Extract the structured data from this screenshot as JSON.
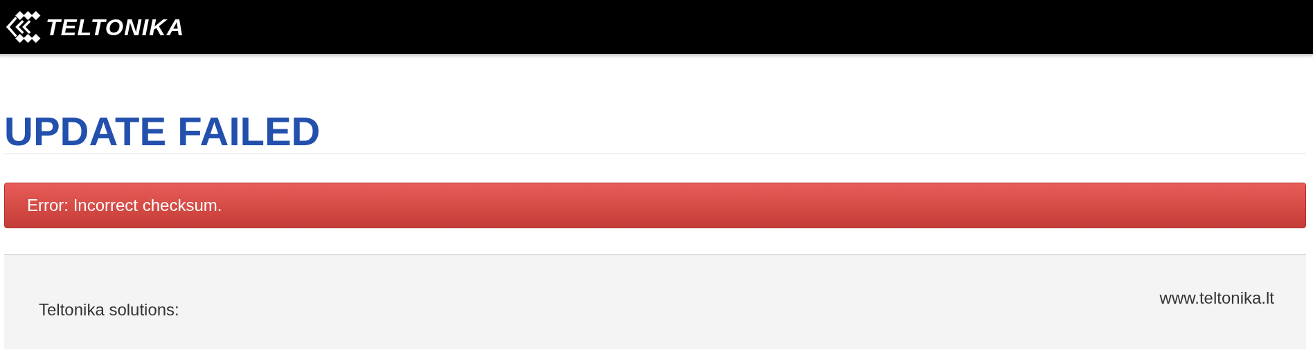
{
  "header": {
    "logo_text": "TELTONIKA"
  },
  "title": "UPDATE FAILED",
  "alert": {
    "kind": "error",
    "message": "Error: Incorrect checksum."
  },
  "footer": {
    "left": "Teltonika solutions:",
    "right": "www.teltonika.lt"
  }
}
